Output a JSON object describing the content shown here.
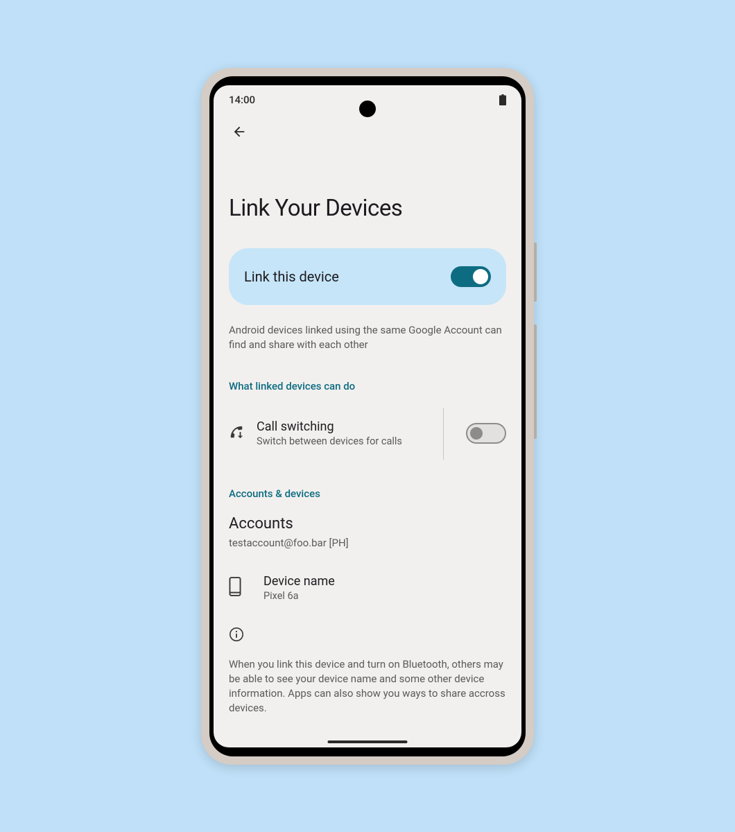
{
  "status_bar": {
    "time": "14:00"
  },
  "page": {
    "title": "Link Your Devices"
  },
  "main_toggle": {
    "label": "Link this device",
    "enabled": true
  },
  "description": "Android devices linked using the same Google Account can find and share with each other",
  "sections": {
    "linked_header": "What linked devices can do",
    "accounts_header": "Accounts & devices"
  },
  "call_switching": {
    "title": "Call switching",
    "subtitle": "Switch between devices for calls",
    "enabled": false
  },
  "accounts": {
    "title": "Accounts",
    "email": "testaccount@foo.bar [PH]"
  },
  "device": {
    "label": "Device name",
    "name": "Pixel 6a"
  },
  "disclosure": "When you link this device and turn on Bluetooth, others may be able to see your device name and some other device information. Apps can also show you ways to share accross devices."
}
